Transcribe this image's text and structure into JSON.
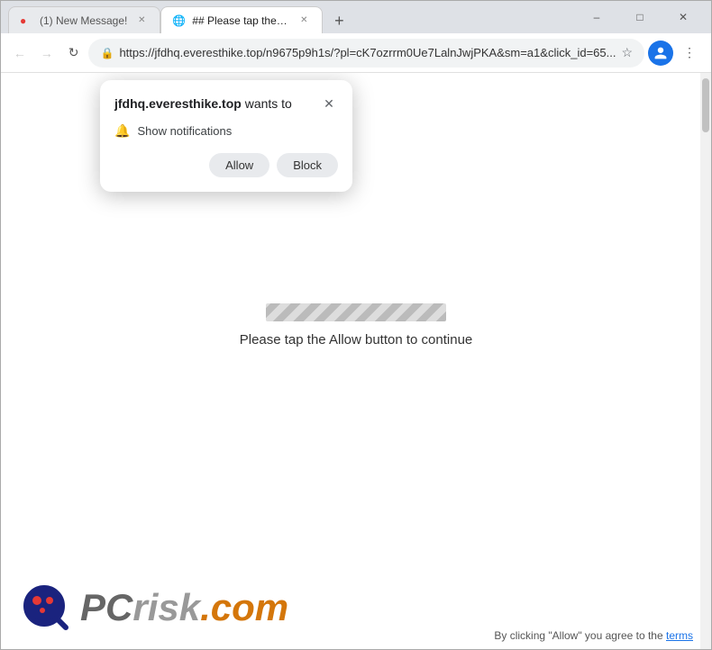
{
  "browser": {
    "tabs": [
      {
        "id": "tab1",
        "favicon": "●",
        "favicon_color": "#e53935",
        "title": "(1) New Message!",
        "active": false
      },
      {
        "id": "tab2",
        "favicon": "🌐",
        "title": "## Please tap the Allow button...",
        "active": true
      }
    ],
    "new_tab_label": "+",
    "window_controls": {
      "minimize": "–",
      "maximize": "□",
      "close": "✕"
    },
    "nav": {
      "back": "←",
      "forward": "→",
      "reload": "↻",
      "url": "https://jfdhq.everesthike.top/n9675p9h1s/?pl=cK7ozrrm0Ue7LalnJwjPKA&sm=a1&click_id=65...",
      "lock_icon": "🔒",
      "star_icon": "☆",
      "profile_icon": "👤",
      "menu_icon": "⋮"
    }
  },
  "popup": {
    "title_prefix": "jfdhq.everesthike.top",
    "title_suffix": " wants to",
    "close_icon": "✕",
    "permission_icon": "🔔",
    "permission_text": "Show notifications",
    "allow_label": "Allow",
    "block_label": "Block"
  },
  "page": {
    "message": "Please tap the Allow button to continue"
  },
  "footer": {
    "pcrisk_logo_text": "PC",
    "pcrisk_risk": "risk",
    "pcrisk_com": ".com",
    "disclaimer": "By clicking \"Allow\" you agree to the",
    "disclaimer_link": "terms"
  }
}
